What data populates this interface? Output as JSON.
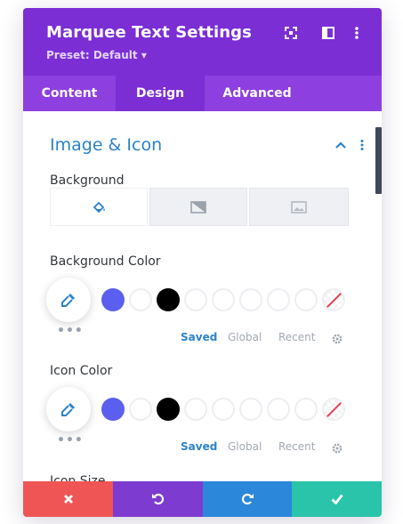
{
  "modal": {
    "title": "Marquee Text Settings",
    "preset": "Preset: Default ▾"
  },
  "header_icons": [
    "fullscreen-icon",
    "sidebar-layout-icon",
    "more-vertical-icon"
  ],
  "tabs": [
    {
      "label": "Content",
      "active": false
    },
    {
      "label": "Design",
      "active": true
    },
    {
      "label": "Advanced",
      "active": false
    }
  ],
  "section": {
    "title": "Image & Icon",
    "controls": [
      "chevron-up-icon",
      "more-vertical-icon"
    ]
  },
  "background": {
    "label": "Background",
    "types": [
      "paint-bucket-icon",
      "gradient-icon",
      "image-icon"
    ],
    "active_type": 0
  },
  "background_color": {
    "label": "Background Color",
    "swatches": [
      "#5b5ff0",
      "empty",
      "#000000",
      "empty",
      "empty",
      "empty",
      "empty",
      "empty",
      "none"
    ],
    "palette_tabs": [
      "Saved",
      "Global",
      "Recent"
    ],
    "active_palette": "Saved"
  },
  "icon_color": {
    "label": "Icon Color",
    "swatches": [
      "#5b5ff0",
      "empty",
      "#000000",
      "empty",
      "empty",
      "empty",
      "empty",
      "empty",
      "none"
    ],
    "palette_tabs": [
      "Saved",
      "Global",
      "Recent"
    ],
    "active_palette": "Saved"
  },
  "icon_size": {
    "label": "Icon Size"
  },
  "footer": {
    "buttons": [
      {
        "name": "cancel",
        "icon": "close-icon",
        "color": "#ef5555"
      },
      {
        "name": "undo",
        "icon": "undo-icon",
        "color": "#7e3bd0"
      },
      {
        "name": "redo",
        "icon": "redo-icon",
        "color": "#2b87da"
      },
      {
        "name": "save",
        "icon": "check-icon",
        "color": "#29c4a9"
      }
    ]
  },
  "colors": {
    "header": "#7b2ed4",
    "tabs": "#8e3fe0",
    "accent": "#2c82c9"
  }
}
